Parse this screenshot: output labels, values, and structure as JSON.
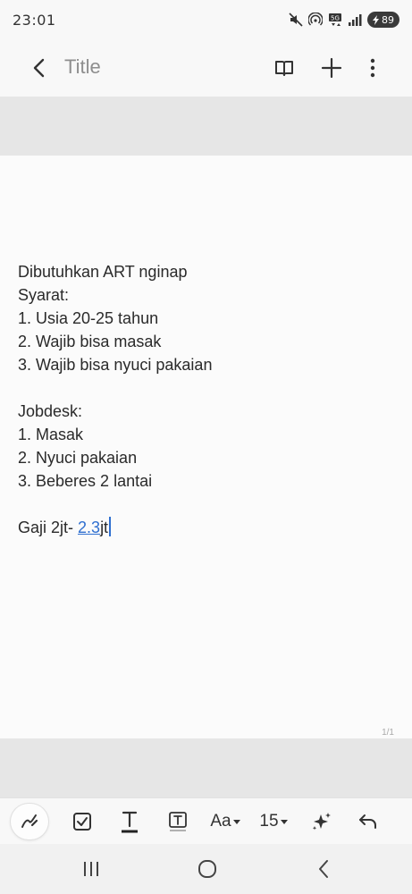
{
  "status_bar": {
    "time": "23:01",
    "battery": "89",
    "icons": [
      "mute-icon",
      "hotspot-icon",
      "5g-icon",
      "signal-icon",
      "battery-icon"
    ]
  },
  "title_bar": {
    "title": "Title",
    "icons": [
      "back-arrow-icon",
      "book-view-icon",
      "add-icon",
      "more-vertical-icon"
    ]
  },
  "note": {
    "lines": [
      "Dibutuhkan ART nginap",
      "Syarat:",
      "1. Usia 20-25 tahun",
      "2. Wajib bisa masak",
      "3. Wajib bisa nyuci pakaian",
      "",
      "Jobdesk:",
      "1. Masak",
      "2. Nyuci pakaian",
      "3. Beberes 2 lantai",
      ""
    ],
    "last_line_prefix": "Gaji 2jt- ",
    "last_line_highlight": "2.3",
    "last_line_suffix": "jt"
  },
  "page_indicator": "1/1",
  "toolbar": {
    "font_label": "Aa",
    "size_label": "15",
    "icons": [
      "pen-icon",
      "checkbox-icon",
      "text-icon",
      "text-box-icon",
      "font-icon",
      "font-size-icon",
      "ai-sparkle-icon",
      "undo-icon"
    ]
  },
  "navbar": {
    "icons": [
      "recent-apps-icon",
      "home-icon",
      "back-icon"
    ]
  }
}
